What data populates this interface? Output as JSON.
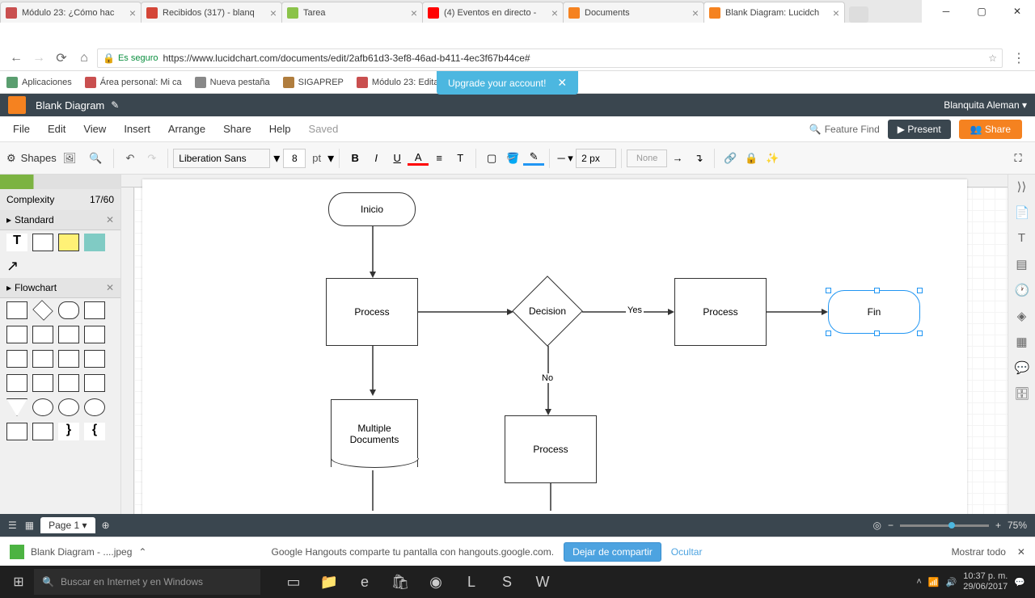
{
  "window": {
    "tabs": [
      {
        "title": "Módulo 23: ¿Cómo hac",
        "favicon": "#c94f4f"
      },
      {
        "title": "Recibidos (317) - blanq",
        "favicon": "#d44638"
      },
      {
        "title": "Tarea",
        "favicon": "#8bc34a"
      },
      {
        "title": "(4) Eventos en directo -",
        "favicon": "#ff0000"
      },
      {
        "title": "Documents",
        "favicon": "#f58220"
      },
      {
        "title": "Blank Diagram: Lucidch",
        "favicon": "#f58220",
        "active": true
      }
    ],
    "secure_label": "Es seguro",
    "url": "https://www.lucidchart.com/documents/edit/2afb61d3-3ef8-46ad-b411-4ec3f67b44ce#"
  },
  "bookmarks": [
    {
      "label": "Aplicaciones",
      "color": "#5a9e6f"
    },
    {
      "label": "Área personal: Mi ca",
      "color": "#c94f4f"
    },
    {
      "label": "Nueva pestaña",
      "color": "#888"
    },
    {
      "label": "SIGAPREP",
      "color": "#b07d3e"
    },
    {
      "label": "Módulo 23: Editar pe",
      "color": "#c94f4f"
    }
  ],
  "app": {
    "doc_title": "Blank Diagram",
    "upgrade": "Upgrade your account!",
    "user": "Blanquita Aleman ▾"
  },
  "menu": {
    "items": [
      "File",
      "Edit",
      "View",
      "Insert",
      "Arrange",
      "Share",
      "Help"
    ],
    "saved": "Saved",
    "feature_find": "Feature Find",
    "present": "▶ Present",
    "share": "Share"
  },
  "toolbar": {
    "shapes": "Shapes",
    "font": "Liberation Sans",
    "size": "8",
    "unit": "pt",
    "stroke_w": "2 px",
    "fill": "None"
  },
  "panel": {
    "complexity_label": "Complexity",
    "complexity_value": "17/60",
    "standard": "Standard",
    "flowchart": "Flowchart"
  },
  "diagram": {
    "inicio": "Inicio",
    "process1": "Process",
    "decision": "Decision",
    "yes": "Yes",
    "no": "No",
    "process2": "Process",
    "fin": "Fin",
    "multidoc": "Multiple\nDocuments",
    "process3": "Process"
  },
  "pagebar": {
    "page": "Page 1 ▾",
    "zoom": "75%"
  },
  "download": {
    "file": "Blank Diagram - ....jpeg"
  },
  "notif": {
    "msg": "Google Hangouts comparte tu pantalla con hangouts.google.com.",
    "stop": "Dejar de compartir",
    "hide": "Ocultar",
    "show_all": "Mostrar todo"
  },
  "taskbar": {
    "search": "Buscar en Internet y en Windows",
    "time": "10:37 p. m.",
    "date": "29/06/2017"
  }
}
